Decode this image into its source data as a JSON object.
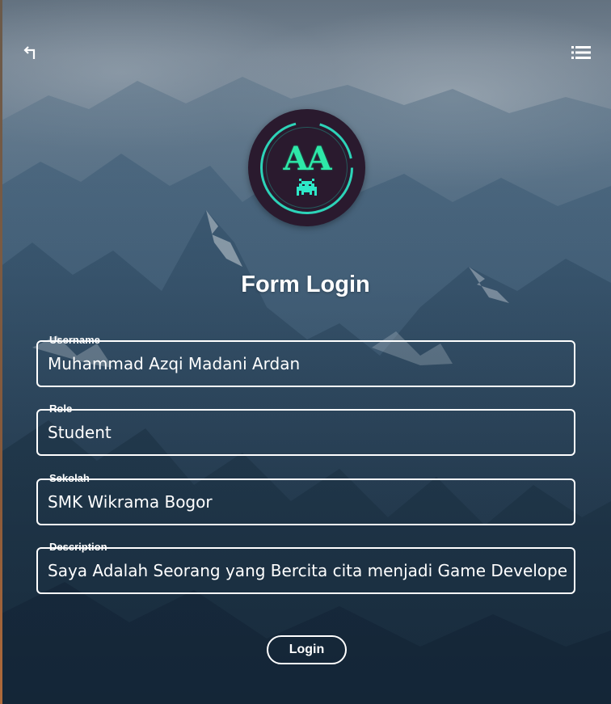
{
  "header": {
    "back_icon": "return-arrow-icon",
    "menu_icon": "list-menu-icon"
  },
  "logo": {
    "text": "AA",
    "icon": "space-invader-icon",
    "ring_color": "#2ee8c8",
    "text_color": "#2ee8a8",
    "background": "#2a1a2e"
  },
  "form": {
    "title": "Form Login",
    "fields": [
      {
        "label": "Username",
        "value": "Muhammad Azqi Madani Ardan"
      },
      {
        "label": "Role",
        "value": "Student"
      },
      {
        "label": "Sekolah",
        "value": "SMK Wikrama Bogor"
      },
      {
        "label": "Description",
        "value": "Saya Adalah Seorang yang Bercita cita menjadi Game Develope"
      }
    ],
    "submit_label": "Login"
  },
  "colors": {
    "accent": "#ffffff",
    "sky_top": "#7a8997",
    "sky_bottom": "#182a3a"
  }
}
